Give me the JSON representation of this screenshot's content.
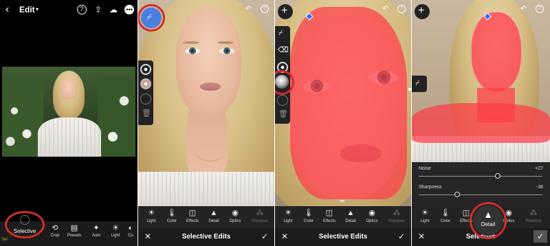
{
  "panel1": {
    "header": {
      "edit_label": "Edit",
      "caret": "▾",
      "help_icon": "help-icon",
      "share_icon": "share-icon",
      "cloud_icon": "cloud-sync-icon",
      "more_icon": "more-icon"
    },
    "strip": {
      "selective_label": "Selective",
      "tools": [
        {
          "icon": "crop-icon",
          "glyph": "⟲",
          "label": "Crop"
        },
        {
          "icon": "presets-icon",
          "glyph": "▤",
          "label": "Presets"
        },
        {
          "icon": "auto-icon",
          "glyph": "✦",
          "label": "Auto"
        },
        {
          "icon": "light-icon",
          "glyph": "☀",
          "label": "Light"
        },
        {
          "icon": "color-icon",
          "glyph": "◐",
          "label": "Co"
        }
      ],
      "left_partial": "Sel"
    }
  },
  "toolbar": {
    "tools": [
      {
        "icon": "light-icon",
        "glyph": "☀",
        "label": "Light"
      },
      {
        "icon": "color-icon",
        "glyph": "🌡",
        "label": "Color"
      },
      {
        "icon": "effects-icon",
        "glyph": "◫",
        "label": "Effects"
      },
      {
        "icon": "detail-icon",
        "glyph": "▲",
        "label": "Detail"
      },
      {
        "icon": "optics-icon",
        "glyph": "◉",
        "label": "Optics"
      },
      {
        "icon": "previous-icon",
        "glyph": "⁂",
        "label": "Previous"
      }
    ],
    "title": "Selective Edits",
    "cancel": "✕",
    "confirm": "✓"
  },
  "panel4": {
    "sliders": [
      {
        "label": "Noise",
        "value": "+27",
        "fraction": 0.64
      },
      {
        "label": "Sharpness",
        "value": "-38",
        "fraction": 0.31
      }
    ],
    "detail_label": "Detail",
    "footer_partial": "Selective"
  },
  "colors": {
    "accent": "#4a7fe0",
    "highlight_ring": "#d62b2b",
    "mask": "#ff3c46"
  }
}
